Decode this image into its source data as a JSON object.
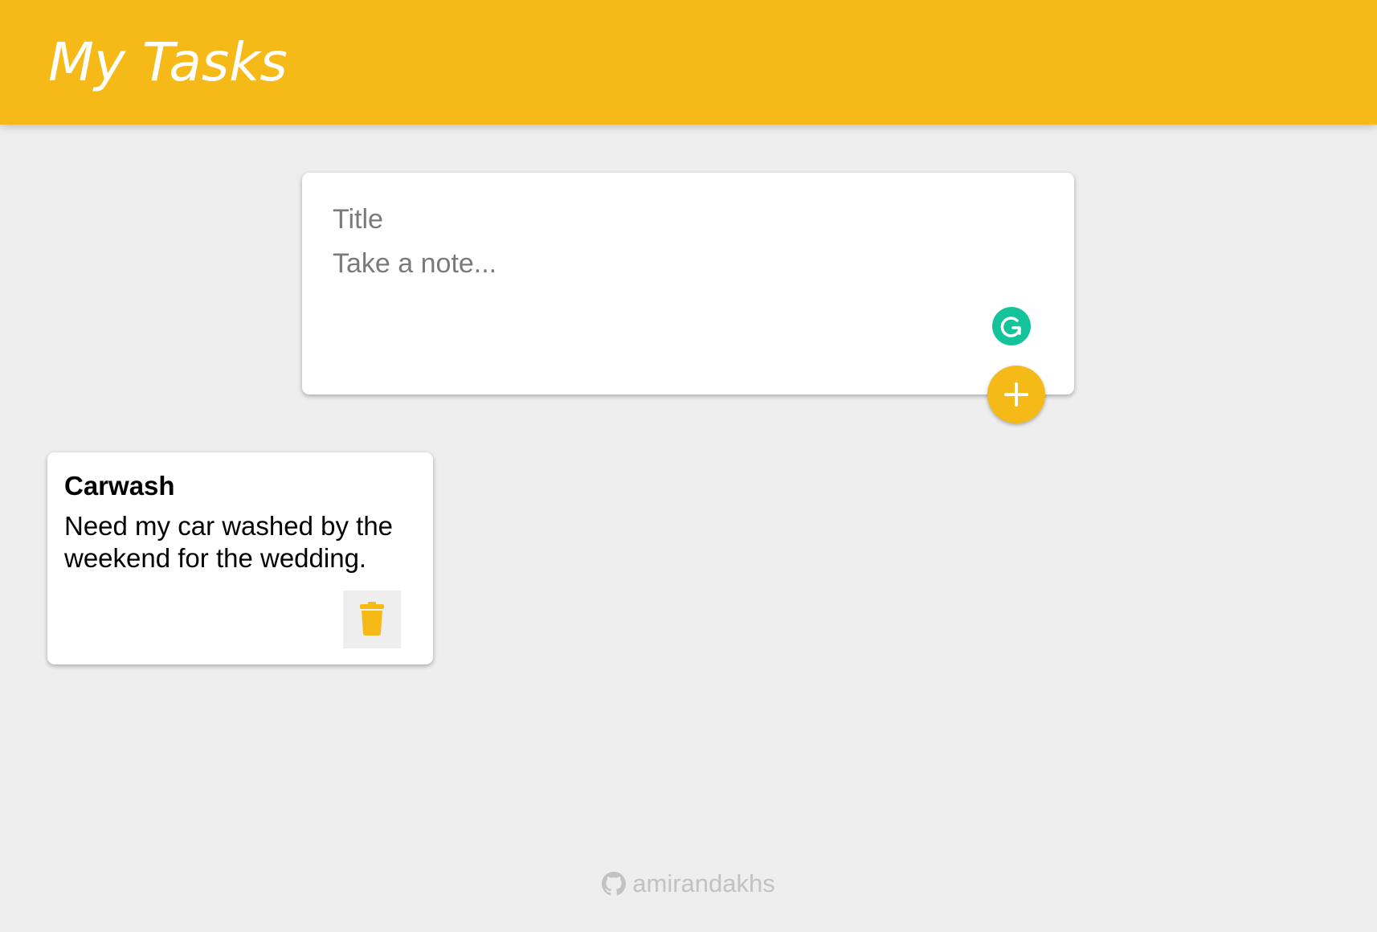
{
  "header": {
    "title": "My Tasks"
  },
  "create_area": {
    "title_placeholder": "Title",
    "note_placeholder": "Take a note...",
    "add_icon": "plus-icon",
    "grammarly_icon": "grammarly-icon"
  },
  "notes": [
    {
      "title": "Carwash",
      "content": "Need my car washed by the weekend for the wedding.",
      "delete_icon": "trash-icon"
    }
  ],
  "footer": {
    "icon": "github-icon",
    "text": "amirandakhs"
  },
  "colors": {
    "accent": "#f5ba18",
    "background": "#eeeeee",
    "grammarly": "#15c39a",
    "footer_text": "#c2c2c2"
  }
}
